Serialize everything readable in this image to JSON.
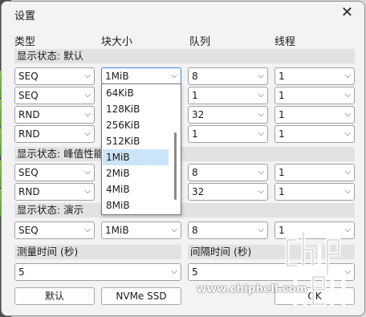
{
  "window": {
    "title": "设置"
  },
  "headers": {
    "type": "类型",
    "block_size": "块大小",
    "queue": "队列",
    "threads": "线程"
  },
  "sections": {
    "default": "显示状态: 默认",
    "peak": "显示状态: 峰值性能",
    "demo": "显示状态: 演示"
  },
  "rows": [
    {
      "type": "SEQ",
      "block": "1MiB",
      "queue": "8",
      "threads": "1"
    },
    {
      "type": "SEQ",
      "block": "",
      "queue": "1",
      "threads": "1"
    },
    {
      "type": "RND",
      "block": "",
      "queue": "32",
      "threads": "1"
    },
    {
      "type": "RND",
      "block": "",
      "queue": "1",
      "threads": "1"
    },
    {
      "type": "SEQ",
      "block": "",
      "queue": "8",
      "threads": "1"
    },
    {
      "type": "RND",
      "block": "",
      "queue": "32",
      "threads": "1"
    },
    {
      "type": "SEQ",
      "block": "1MiB",
      "queue": "8",
      "threads": "1"
    }
  ],
  "dropdown": {
    "options": [
      "64KiB",
      "128KiB",
      "256KiB",
      "512KiB",
      "1MiB",
      "2MiB",
      "4MiB",
      "8MiB"
    ],
    "selected": "1MiB"
  },
  "measure_time": {
    "label": "测量时间 (秒)",
    "value": "5"
  },
  "interval_time": {
    "label": "间隔时间 (秒)",
    "value": "5"
  },
  "buttons": {
    "default": "默认",
    "nvme": "NVMe SSD",
    "ok": "OK"
  },
  "watermark": {
    "text": "www.chiphell.com"
  },
  "colors": {
    "accent": "#3d7ee0",
    "dropdown_highlight": "#cce4f7",
    "section_bg": "#e2e2e2"
  },
  "icons": {
    "dropdown_arrow": "chevron-down-icon",
    "close": "close-icon"
  }
}
